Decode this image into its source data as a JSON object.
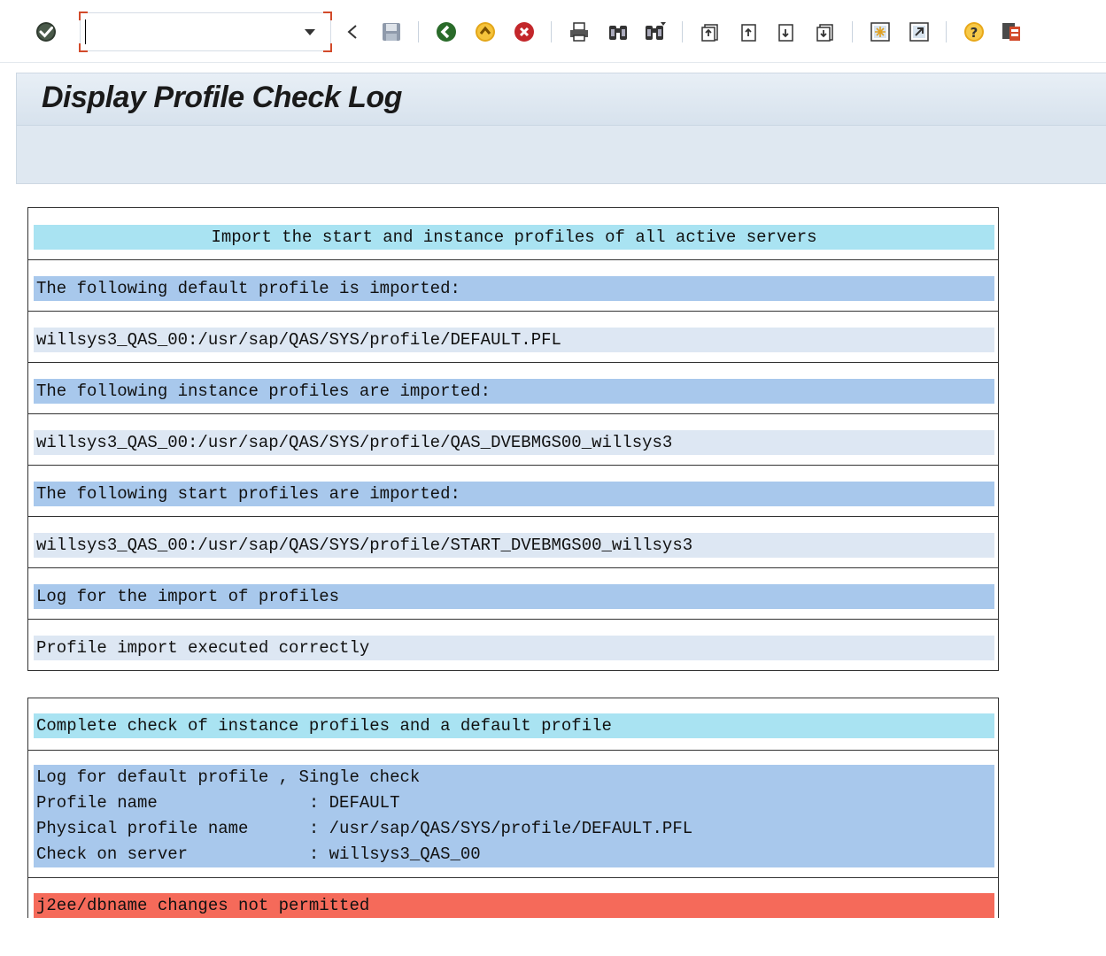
{
  "toolbar": {
    "command_field": {
      "value": "",
      "placeholder": ""
    },
    "buttons": [
      "enter-icon",
      "back-arrow-icon",
      "save-icon",
      "back-icon",
      "exit-icon",
      "cancel-icon",
      "print-icon",
      "find-icon",
      "find-next-icon",
      "first-page-icon",
      "previous-page-icon",
      "next-page-icon",
      "last-page-icon",
      "create-session-icon",
      "shortcut-icon",
      "help-icon",
      "customize-layout-icon"
    ]
  },
  "title": "Display Profile Check Log",
  "colors": {
    "cyan_bar": "#a9e3f2",
    "blue_bar": "#a8c8ec",
    "light_bar": "#dde7f3",
    "error_bar": "#f56a5a",
    "title_bg": "#dfe8f1"
  },
  "section1": {
    "header": "Import the start and instance profiles of all active servers",
    "rows": [
      "The following default profile is imported:",
      "willsys3_QAS_00:/usr/sap/QAS/SYS/profile/DEFAULT.PFL",
      "The following instance profiles are imported:",
      "willsys3_QAS_00:/usr/sap/QAS/SYS/profile/QAS_DVEBMGS00_willsys3",
      "The following start profiles are imported:",
      "willsys3_QAS_00:/usr/sap/QAS/SYS/profile/START_DVEBMGS00_willsys3",
      "Log for the import of profiles",
      "Profile import executed correctly"
    ]
  },
  "section2": {
    "header": "Complete check of instance profiles and a default profile",
    "details": [
      "Log for default profile , Single check",
      "Profile name               : DEFAULT",
      "Physical profile name      : /usr/sap/QAS/SYS/profile/DEFAULT.PFL",
      "Check on server            : willsys3_QAS_00"
    ],
    "error": "j2ee/dbname changes not permitted"
  }
}
